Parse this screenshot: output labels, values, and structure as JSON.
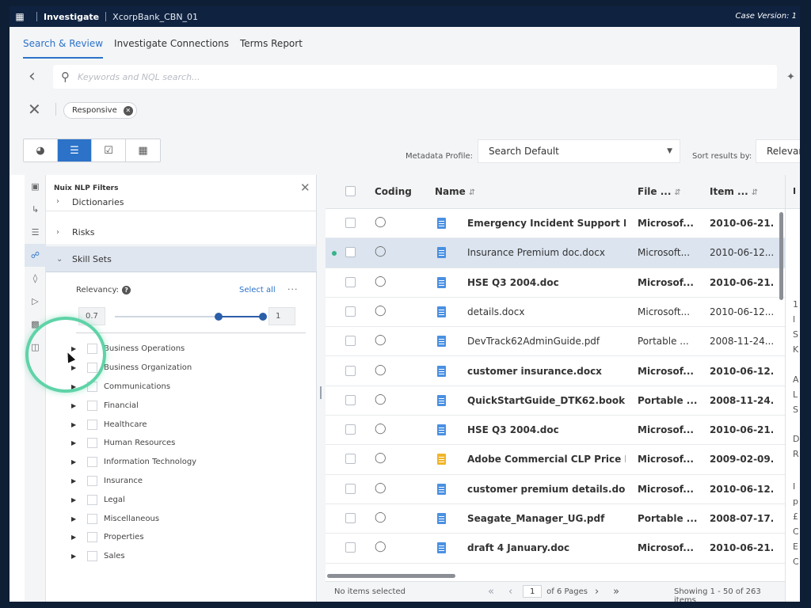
{
  "topbar": {
    "app_name": "Investigate",
    "case_name": "XcorpBank_CBN_01",
    "case_version": "Case Version: 1"
  },
  "nav": {
    "tabs": [
      {
        "label": "Search & Review",
        "active": true
      },
      {
        "label": "Investigate Connections",
        "active": false
      },
      {
        "label": "Terms Report",
        "active": false
      }
    ]
  },
  "search": {
    "placeholder": "Keywords and NQL search...",
    "chip": "Responsive"
  },
  "toolbar": {
    "metadata_label": "Metadata Profile:",
    "metadata_value": "Search Default",
    "sort_label": "Sort results by:",
    "sort_value": "Relevance"
  },
  "filters": {
    "title": "Nuix NLP Filters",
    "partial_facet": "Dictionaries",
    "facets": [
      "Risks",
      "Skill Sets"
    ],
    "relevancy_label": "Relevancy:",
    "select_all": "Select all",
    "min": "0.7",
    "max": "1",
    "slider_low": 0.7,
    "slider_high": 1,
    "skills": [
      "Business Operations",
      "Business Organization",
      "Communications",
      "Financial",
      "Healthcare",
      "Human Resources",
      "Information Technology",
      "Insurance",
      "Legal",
      "Miscellaneous",
      "Properties",
      "Sales"
    ]
  },
  "results": {
    "headers": {
      "coding": "Coding",
      "name": "Name",
      "file": "File ...",
      "item": "Item ..."
    },
    "rows": [
      {
        "name": "Emergency Incident Support P...",
        "file": "Microsof...",
        "item": "2010-06-21...",
        "bold": true,
        "type": "word"
      },
      {
        "name": "Insurance Premium doc.docx",
        "file": "Microsoft...",
        "item": "2010-06-12...",
        "bold": false,
        "type": "word",
        "selected": true
      },
      {
        "name": "HSE Q3 2004.doc",
        "file": "Microsof...",
        "item": "2010-06-21...",
        "bold": true,
        "type": "word"
      },
      {
        "name": "details.docx",
        "file": "Microsoft...",
        "item": "2010-06-12...",
        "bold": false,
        "type": "word"
      },
      {
        "name": "DevTrack62AdminGuide.pdf",
        "file": "Portable ...",
        "item": "2008-11-24...",
        "bold": false,
        "type": "pdf"
      },
      {
        "name": "customer insurance.docx",
        "file": "Microsof...",
        "item": "2010-06-12...",
        "bold": true,
        "type": "word"
      },
      {
        "name": "QuickStartGuide_DTK62.book....",
        "file": "Portable ...",
        "item": "2008-11-24...",
        "bold": true,
        "type": "pdf"
      },
      {
        "name": "HSE Q3 2004.doc",
        "file": "Microsof...",
        "item": "2010-06-21...",
        "bold": true,
        "type": "word"
      },
      {
        "name": "Adobe Commercial CLP Price L...",
        "file": "Microsof...",
        "item": "2009-02-09...",
        "bold": true,
        "type": "excel"
      },
      {
        "name": "customer premium details.docx",
        "file": "Microsof...",
        "item": "2010-06-12...",
        "bold": true,
        "type": "word"
      },
      {
        "name": "Seagate_Manager_UG.pdf",
        "file": "Portable ...",
        "item": "2008-07-17...",
        "bold": true,
        "type": "pdf"
      },
      {
        "name": "draft 4 January.doc",
        "file": "Microsof...",
        "item": "2010-06-21...",
        "bold": true,
        "type": "word"
      }
    ],
    "footer": {
      "no_items": "No items selected",
      "page": "1",
      "of_pages": "of 6 Pages",
      "showing": "Showing 1 - 50 of 263 items"
    }
  },
  "preview": {
    "tab": "I",
    "lines": [
      "1",
      "l",
      "S",
      "K",
      "A",
      "L",
      "S",
      "D",
      "R",
      "I",
      "p",
      "£",
      "C",
      "E",
      "C"
    ]
  }
}
